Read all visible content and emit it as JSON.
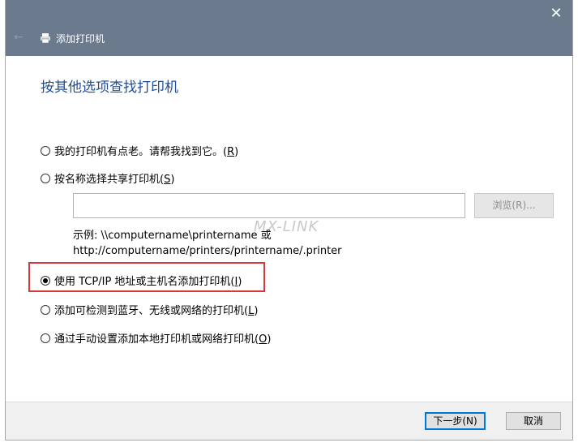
{
  "window": {
    "title": "添加打印机",
    "close_glyph": "✕",
    "back_glyph": "←"
  },
  "heading": "按其他选项查找打印机",
  "options": [
    {
      "text": "我的打印机有点老。请帮我找到它。",
      "key": "R",
      "checked": false
    },
    {
      "text": "按名称选择共享打印机",
      "key": "S",
      "checked": false
    },
    {
      "text": "使用 TCP/IP 地址或主机名添加打印机",
      "key": "I",
      "checked": true
    },
    {
      "text": "添加可检测到蓝牙、无线或网络的打印机",
      "key": "L",
      "checked": false
    },
    {
      "text": "通过手动设置添加本地打印机或网络打印机",
      "key": "O",
      "checked": false
    }
  ],
  "shared_printer": {
    "value": "",
    "browse_label": "浏览(R)...",
    "example_line1": "示例: \\\\computername\\printername 或",
    "example_line2": "http://computername/printers/printername/.printer"
  },
  "watermark": "MX-LINK",
  "footer": {
    "next_label": "下一步(N)",
    "cancel_label": "取消"
  },
  "colors": {
    "titlebar": "#6b7a8d",
    "heading": "#1e4f9a",
    "highlight": "#d23b3b"
  }
}
